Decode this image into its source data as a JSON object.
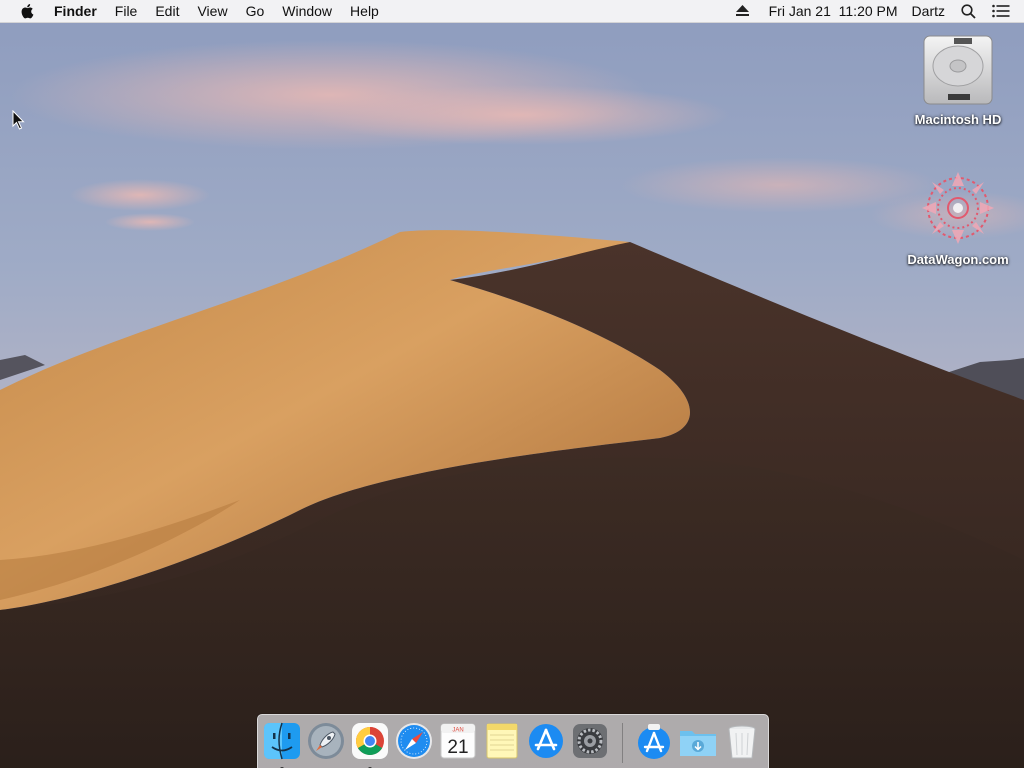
{
  "menubar": {
    "apple_icon": "apple-logo-icon",
    "app_name": "Finder",
    "menus": [
      "File",
      "Edit",
      "View",
      "Go",
      "Window",
      "Help"
    ],
    "clock": "Fri Jan 21  11:20 PM",
    "user": "Dartz",
    "status_icons": [
      "eject-icon",
      "spotlight-search-icon",
      "notification-center-icon"
    ]
  },
  "desktop": {
    "icons": [
      {
        "label": "Macintosh HD",
        "icon": "hard-drive-icon"
      },
      {
        "label": "DataWagon.com",
        "icon": "datawagon-disk-icon"
      }
    ]
  },
  "dock": {
    "apps": [
      {
        "name": "Finder",
        "icon": "finder-icon",
        "running": true
      },
      {
        "name": "Launchpad",
        "icon": "launchpad-icon",
        "running": false
      },
      {
        "name": "Google Chrome",
        "icon": "chrome-icon",
        "running": true
      },
      {
        "name": "Safari",
        "icon": "safari-icon",
        "running": false
      },
      {
        "name": "Calendar",
        "icon": "calendar-icon",
        "running": false,
        "month": "JAN",
        "day": "21"
      },
      {
        "name": "Notes",
        "icon": "notes-icon",
        "running": false
      },
      {
        "name": "App Store",
        "icon": "app-store-icon",
        "running": false
      },
      {
        "name": "System Preferences",
        "icon": "system-preferences-icon",
        "running": false
      }
    ],
    "stacks": [
      {
        "name": "Applications",
        "icon": "applications-stack-icon"
      },
      {
        "name": "Downloads",
        "icon": "downloads-folder-icon"
      },
      {
        "name": "Trash",
        "icon": "trash-icon"
      }
    ]
  },
  "colors": {
    "sky_top": "#8f9ec0",
    "dune_light": "#d49a55",
    "dune_shadow": "#3b2a22",
    "menubar_bg": "#f6f6f6"
  }
}
